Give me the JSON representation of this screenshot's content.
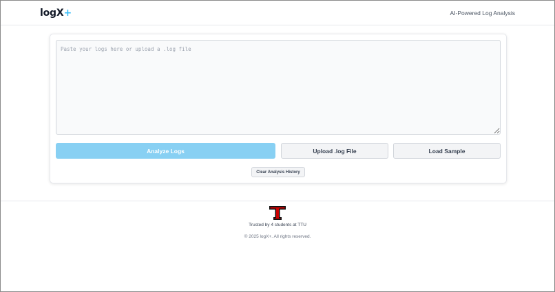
{
  "header": {
    "logo_text": "logX",
    "logo_accent": "+",
    "tagline": "AI-Powered Log Analysis"
  },
  "main": {
    "log_input": {
      "placeholder": "Paste your logs here or upload a .log file",
      "value": ""
    },
    "analyze_label": "Analyze Logs",
    "upload_label": "Upload .log File",
    "sample_label": "Load Sample",
    "clear_history_label": "Clear Analysis History"
  },
  "footer": {
    "logo_icon": "ttu-double-t-icon",
    "trusted_text": "Trusted by 4 students at TTU",
    "copyright": "© 2025 logX+. All rights reserved."
  },
  "colors": {
    "accent": "#38bdf8",
    "analyze_button": "#88d0f3",
    "ttu_red": "#cc0000"
  }
}
